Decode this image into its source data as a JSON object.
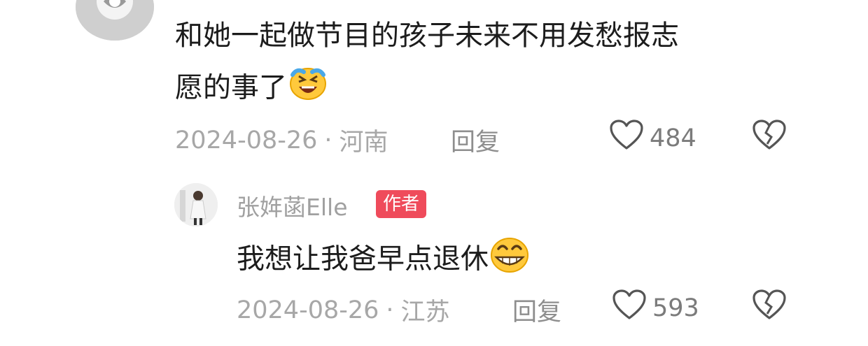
{
  "comment1": {
    "line1": "和她一起做节目的孩子未来不用发愁报志",
    "line2": "愿的事了",
    "emoji": "laughing-crying-emoji",
    "date": "2024-08-26",
    "separator": "·",
    "location": "河南",
    "reply_label": "回复",
    "likes": "484"
  },
  "reply1": {
    "username": "张姩菡Elle",
    "badge": "作者",
    "text": "我想让我爸早点退休",
    "emoji": "grinning-emoji",
    "date": "2024-08-26",
    "separator": "·",
    "location": "江苏",
    "reply_label": "回复",
    "likes": "593"
  },
  "icons": {
    "like": "heart-outline-icon",
    "dislike": "broken-heart-icon"
  },
  "colors": {
    "badge_bg": "#ef4b5b",
    "meta_text": "#a7a7a7",
    "body_text": "#1c1c1c"
  }
}
